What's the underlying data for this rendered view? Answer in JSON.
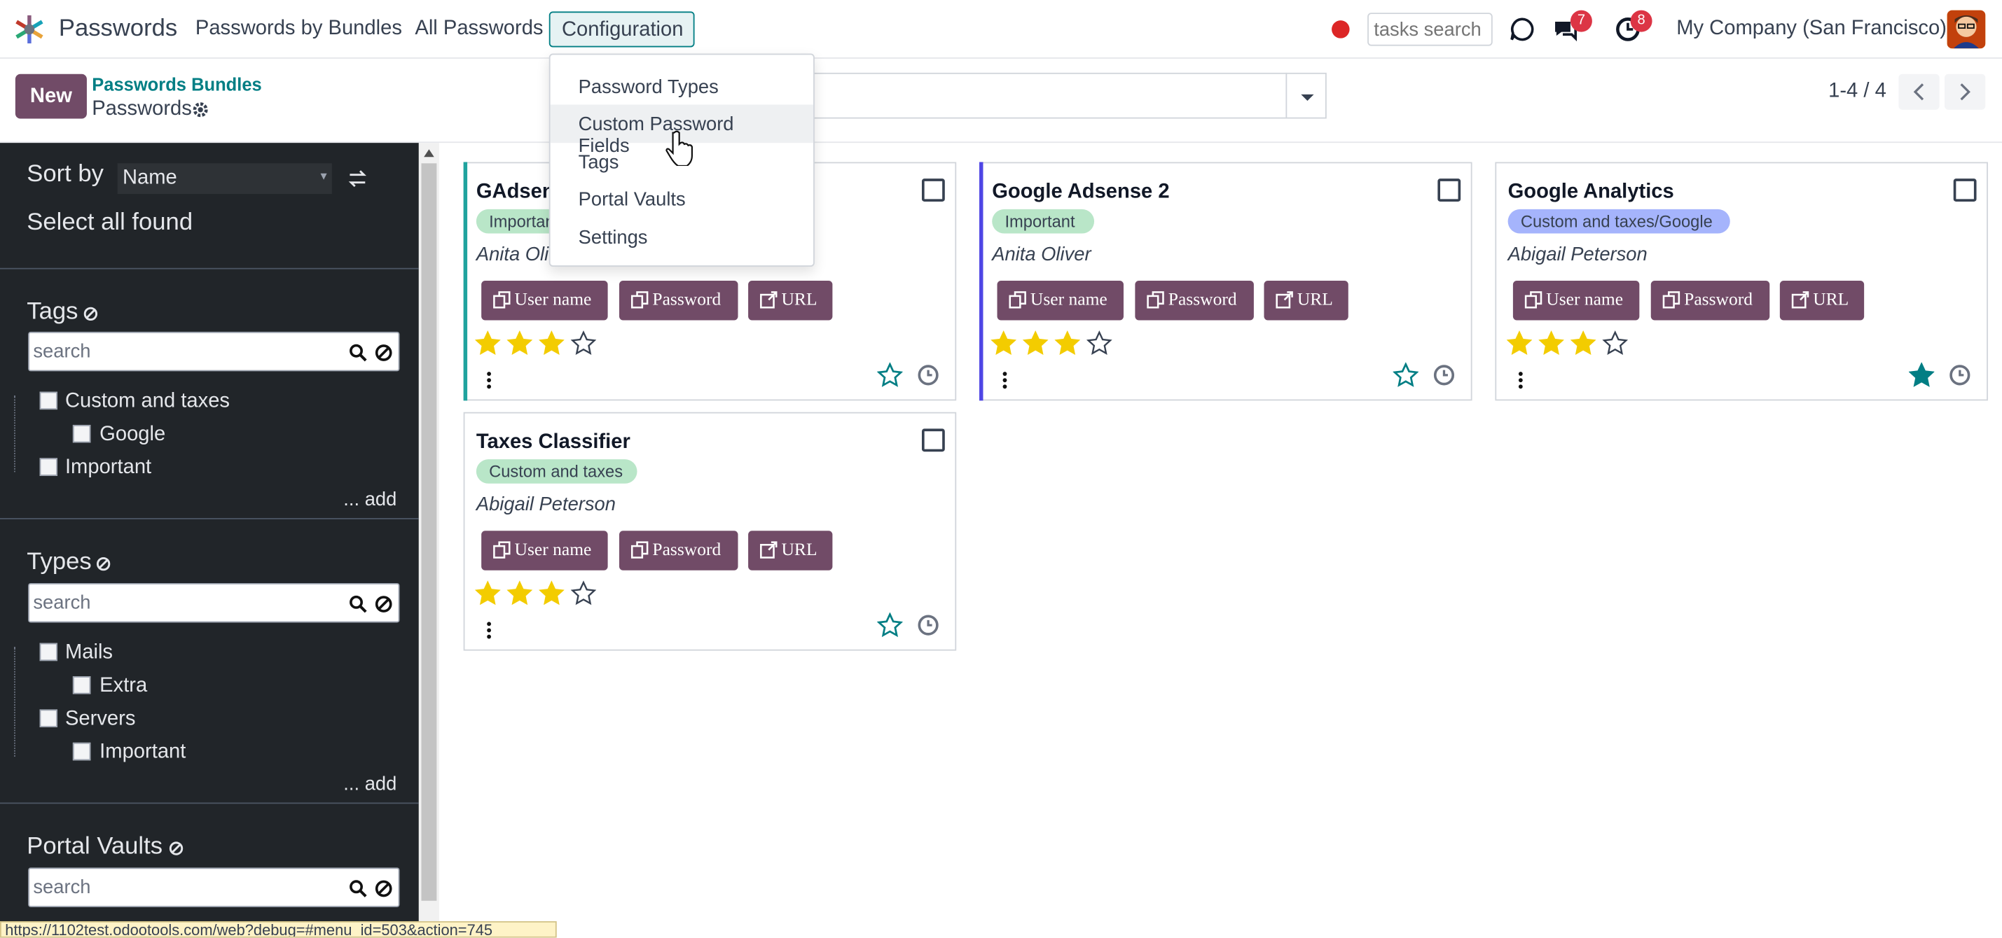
{
  "navbar": {
    "app_name": "Passwords",
    "menus": [
      "Passwords by Bundles",
      "All Passwords",
      "Configuration"
    ],
    "tasks_search_placeholder": "tasks search",
    "chat_badge": "7",
    "activity_badge": "8",
    "company": "My Company (San Francisco)"
  },
  "control_panel": {
    "new_label": "New",
    "breadcrumb_parent": "Passwords Bundles",
    "breadcrumb_current": "Passwords",
    "pager": "1-4 / 4"
  },
  "config_menu": {
    "items": [
      "Password Types",
      "Custom Password Fields",
      "Tags",
      "Portal Vaults",
      "Settings"
    ],
    "highlighted": "Custom Password Fields"
  },
  "sidebar": {
    "sort_label": "Sort by",
    "sort_value": "Name",
    "select_all": "Select all found",
    "tags": {
      "title": "Tags",
      "search_placeholder": "search",
      "items": [
        "Custom and taxes",
        "Google",
        "Important"
      ],
      "add": "... add"
    },
    "types": {
      "title": "Types",
      "search_placeholder": "search",
      "items": [
        "Mails",
        "Extra",
        "Servers",
        "Important"
      ],
      "add": "... add"
    },
    "portal_vaults": {
      "title": "Portal Vaults",
      "search_placeholder": "search"
    }
  },
  "cards": [
    {
      "title": "GAdsense",
      "tag": "Important",
      "owner": "Anita Oliver",
      "stars": 3,
      "favorite": false,
      "accent": "#20a39e",
      "tag_color": "#b9e6c8"
    },
    {
      "title": "Google Adsense 2",
      "tag": "Important",
      "owner": "Anita Oliver",
      "stars": 3,
      "favorite": false,
      "accent": "#4f46e5",
      "tag_color": "#b9e6c8"
    },
    {
      "title": "Google Analytics",
      "tag": "Custom and taxes/Google",
      "owner": "Abigail Peterson",
      "stars": 3,
      "favorite": true,
      "accent": "",
      "tag_color": "#a5b4fc"
    },
    {
      "title": "Taxes Classifier",
      "tag": "Custom and taxes",
      "owner": "Abigail Peterson",
      "stars": 3,
      "favorite": false,
      "accent": "",
      "tag_color": "#b9e6c8"
    }
  ],
  "card_buttons": [
    "User name",
    "Password",
    "URL"
  ],
  "status_url": "https://1102test.odootools.com/web?debug=#menu_id=503&action=745",
  "colors": {
    "primary": "#714b67",
    "accent": "#017e84",
    "star": "#f3cc00",
    "sidebar_bg": "#212529"
  }
}
